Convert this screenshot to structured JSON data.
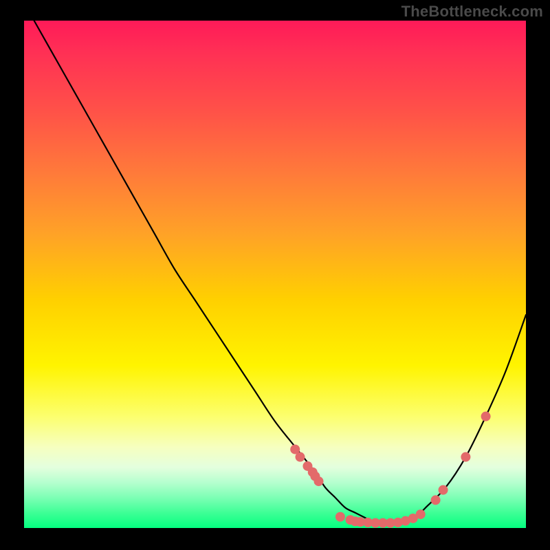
{
  "watermark": "TheBottleneck.com",
  "chart_data": {
    "type": "line",
    "title": "",
    "xlabel": "",
    "ylabel": "",
    "xlim": [
      0,
      100
    ],
    "ylim": [
      0,
      100
    ],
    "grid": false,
    "series": [
      {
        "name": "curve",
        "x": [
          2,
          6,
          10,
          14,
          18,
          22,
          26,
          30,
          34,
          38,
          42,
          46,
          50,
          54,
          58,
          60,
          62,
          64,
          66,
          68,
          70,
          72,
          74,
          76,
          78,
          80,
          84,
          88,
          92,
          96,
          100
        ],
        "y": [
          100,
          93,
          86,
          79,
          72,
          65,
          58,
          51,
          45,
          39,
          33,
          27,
          21,
          16,
          11,
          8,
          6,
          4,
          3,
          2,
          1,
          1,
          1,
          1,
          2,
          4,
          8,
          14,
          22,
          31,
          42
        ]
      }
    ],
    "markers": [
      {
        "x": 54,
        "y": 15.5
      },
      {
        "x": 55,
        "y": 14
      },
      {
        "x": 56.5,
        "y": 12.2
      },
      {
        "x": 57.5,
        "y": 11
      },
      {
        "x": 58,
        "y": 10.2
      },
      {
        "x": 58.7,
        "y": 9.2
      },
      {
        "x": 63,
        "y": 2.2
      },
      {
        "x": 65,
        "y": 1.6
      },
      {
        "x": 66,
        "y": 1.3
      },
      {
        "x": 67,
        "y": 1.2
      },
      {
        "x": 68.5,
        "y": 1.1
      },
      {
        "x": 70,
        "y": 1.0
      },
      {
        "x": 71.5,
        "y": 1.0
      },
      {
        "x": 73,
        "y": 1.0
      },
      {
        "x": 74.5,
        "y": 1.1
      },
      {
        "x": 76,
        "y": 1.4
      },
      {
        "x": 77.5,
        "y": 1.9
      },
      {
        "x": 79,
        "y": 2.7
      },
      {
        "x": 82,
        "y": 5.5
      },
      {
        "x": 83.5,
        "y": 7.5
      },
      {
        "x": 88,
        "y": 14
      },
      {
        "x": 92,
        "y": 22
      }
    ],
    "marker_style": {
      "radius_px": 7,
      "fill": "#e36a6a"
    },
    "curve_style": {
      "stroke": "#000000",
      "stroke_width_px": 2.2
    }
  }
}
